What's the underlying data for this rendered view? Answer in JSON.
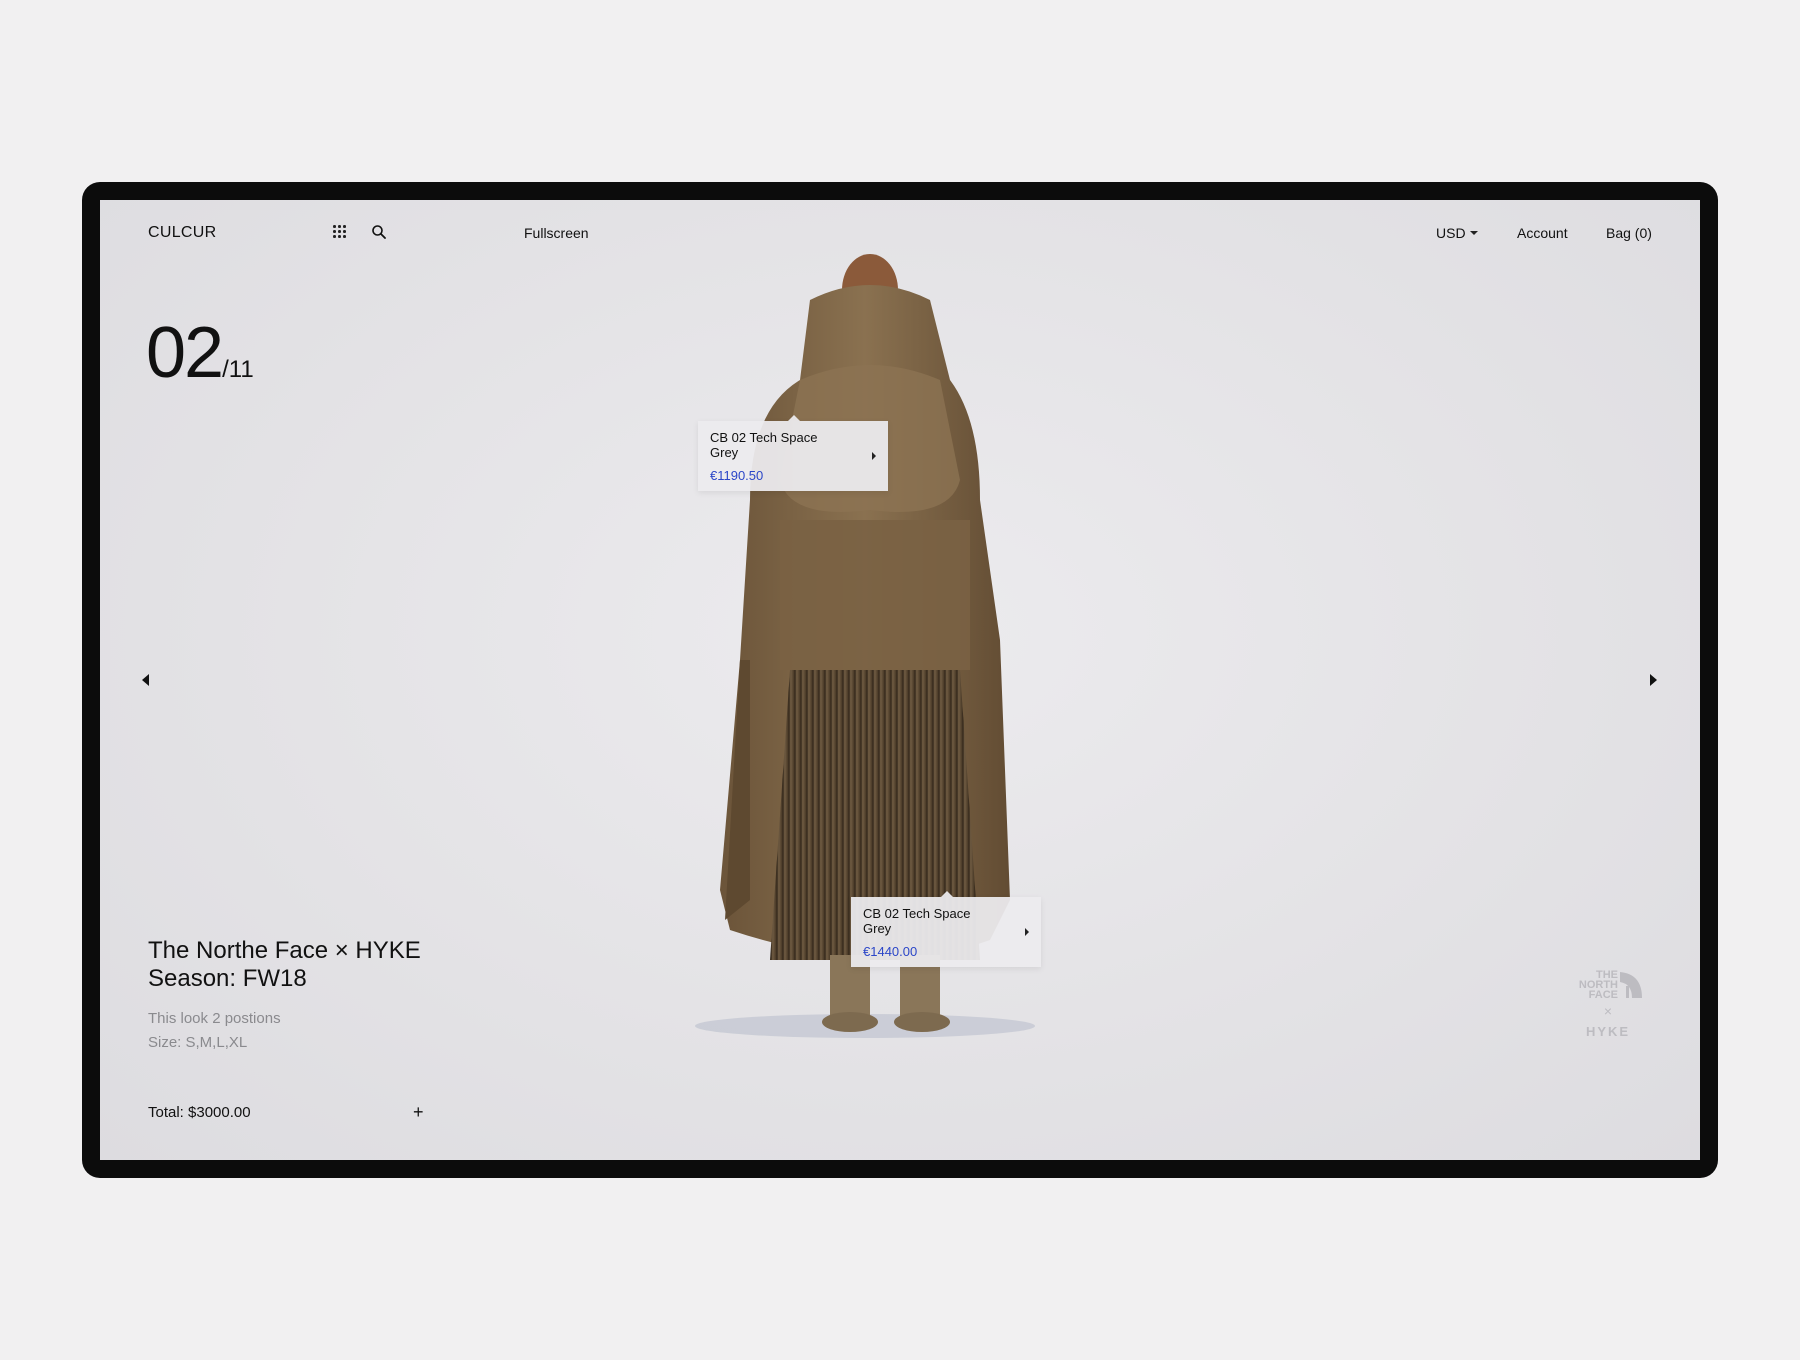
{
  "header": {
    "logo": "CULCUR",
    "fullscreen_label": "Fullscreen",
    "currency": "USD",
    "account_label": "Account",
    "bag_label": "Bag (0)"
  },
  "icons": [
    "grid-icon",
    "search-icon",
    "chevron-left-icon",
    "chevron-right-icon",
    "plus-icon",
    "caret-down-icon"
  ],
  "counter": {
    "current": "02",
    "total": "/11"
  },
  "look": {
    "title_line1": "The Northe Face × HYKE",
    "title_line2": "Season: FW18",
    "positions": "This look 2 postions",
    "sizes": "Size: S,M,L,XL",
    "total": "Total: $3000.00",
    "add_symbol": "+"
  },
  "tags": [
    {
      "name": "CB 02 Tech Space Grey",
      "price": "€1190.50"
    },
    {
      "name": "CB 02 Tech Space Grey",
      "price": "€1440.00"
    }
  ],
  "brand_logo": {
    "line1": "THE",
    "line2": "NORTH",
    "line3": "FACE",
    "cross": "×",
    "collab": "HYKE"
  },
  "colors": {
    "accent_price": "#2b46c8",
    "frame": "#0c0c0c",
    "background": "#f1f0f1",
    "coat": "#7a6244"
  }
}
